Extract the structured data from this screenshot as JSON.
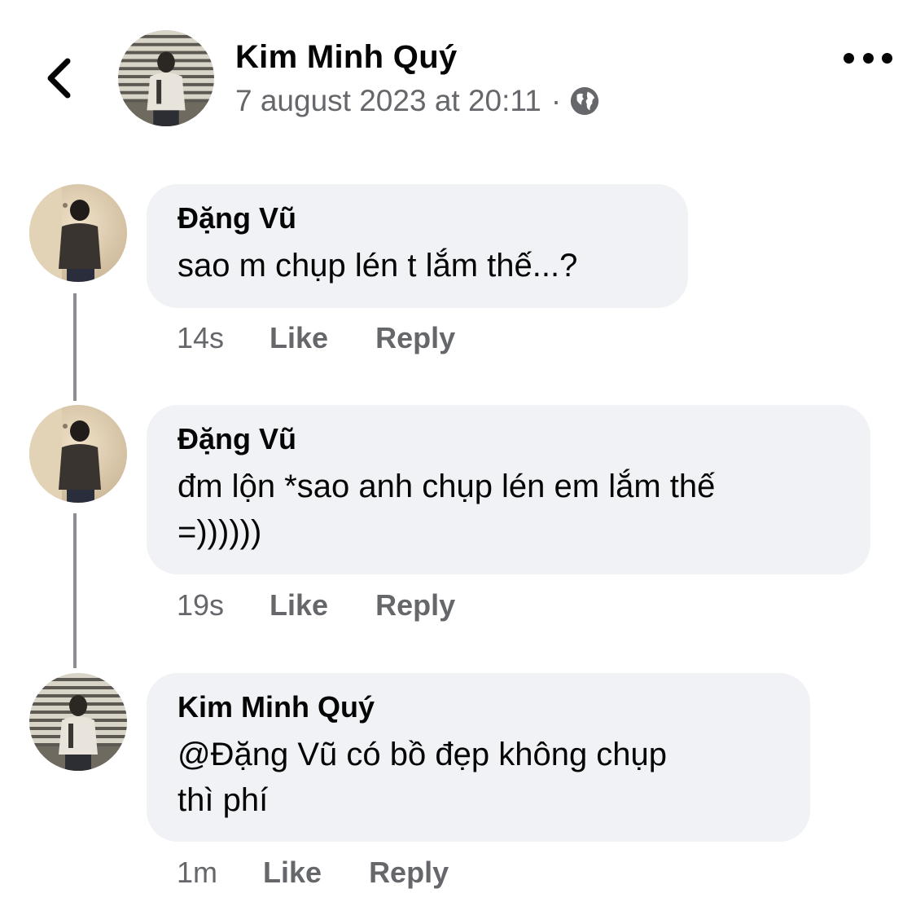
{
  "header": {
    "back_icon": "chevron-left-icon",
    "author_name": "Kim Minh Quý",
    "timestamp": "7 august 2023 at 20:11",
    "separator": "·",
    "privacy_icon": "globe-icon",
    "more_icon": "more-horizontal-icon"
  },
  "comments": [
    {
      "author": "Đặng Vũ",
      "text": "sao m chụp lén t lắm thế...?",
      "time": "14s",
      "like_label": "Like",
      "reply_label": "Reply"
    },
    {
      "author": "Đặng Vũ",
      "text_line1": "đm lộn *sao anh chụp lén em lắm thế",
      "text_line2": "=))))))",
      "time": "19s",
      "like_label": "Like",
      "reply_label": "Reply"
    },
    {
      "author": "Kim Minh Quý",
      "text_line1": "@Đặng Vũ có bồ đẹp không chụp",
      "text_line2": "thì phí",
      "time": "1m",
      "like_label": "Like",
      "reply_label": "Reply"
    }
  ],
  "colors": {
    "bubble": "#f0f2f5",
    "meta_text": "#65676b",
    "primary_text": "#050505"
  }
}
